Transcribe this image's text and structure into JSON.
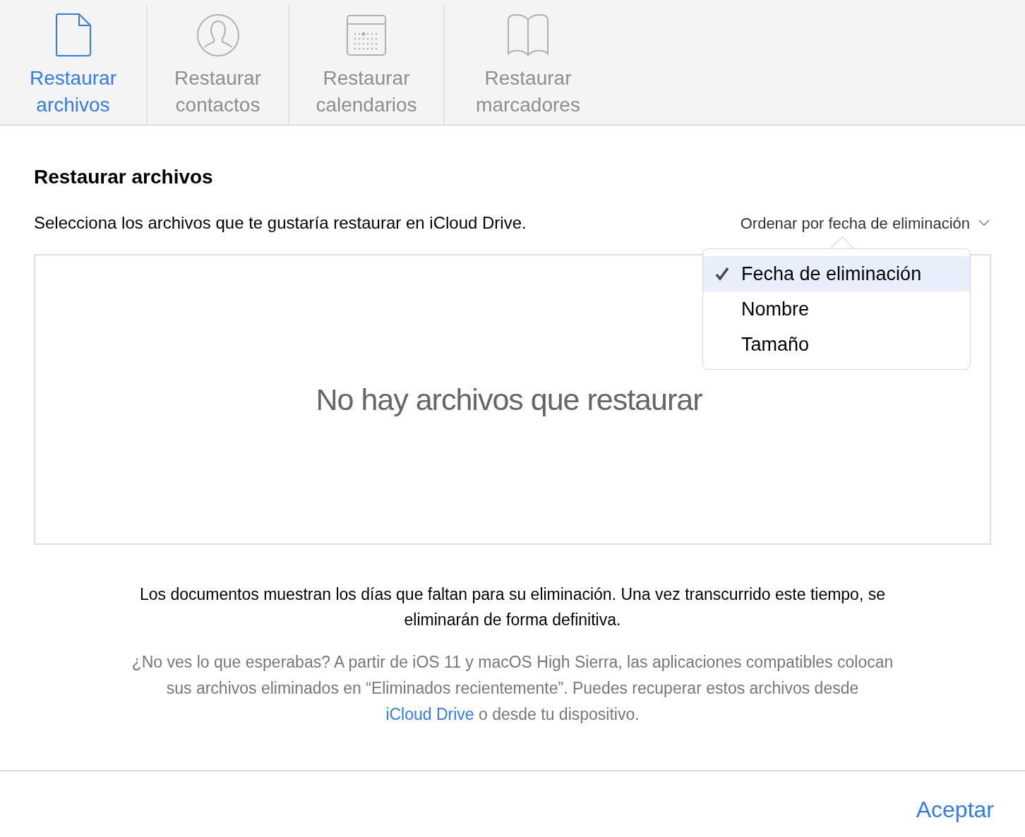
{
  "tabs": [
    {
      "kind": "file",
      "label": "Restaurar archivos",
      "selected": true
    },
    {
      "kind": "contact",
      "label": "Restaurar contactos",
      "selected": false
    },
    {
      "kind": "calendar",
      "label": "Restaurar calendarios",
      "selected": false
    },
    {
      "kind": "bookmark",
      "label": "Restaurar marcadores",
      "selected": false
    }
  ],
  "heading": "Restaurar archivos",
  "instruction": "Selecciona los archivos que te gustaría restaurar en iCloud Drive.",
  "sort": {
    "label": "Ordenar por fecha de eliminación",
    "options": [
      {
        "label": "Fecha de eliminación",
        "selected": true
      },
      {
        "label": "Nombre",
        "selected": false
      },
      {
        "label": "Tamaño",
        "selected": false
      }
    ]
  },
  "empty_message": "No hay archivos que restaurar",
  "note": "Los documentos muestran los días que faltan para su eliminación. Una vez transcurrido este tiempo, se eliminarán de forma definitiva.",
  "help": {
    "before": "¿No ves lo que esperabas? A partir de iOS 11 y macOS High Sierra, las aplicaciones compatibles colocan sus archivos eliminados en “Eliminados recientemente”. Puedes recuperar estos archivos desde",
    "link": "iCloud Drive",
    "after": "o desde tu dispositivo."
  },
  "button": "Aceptar"
}
